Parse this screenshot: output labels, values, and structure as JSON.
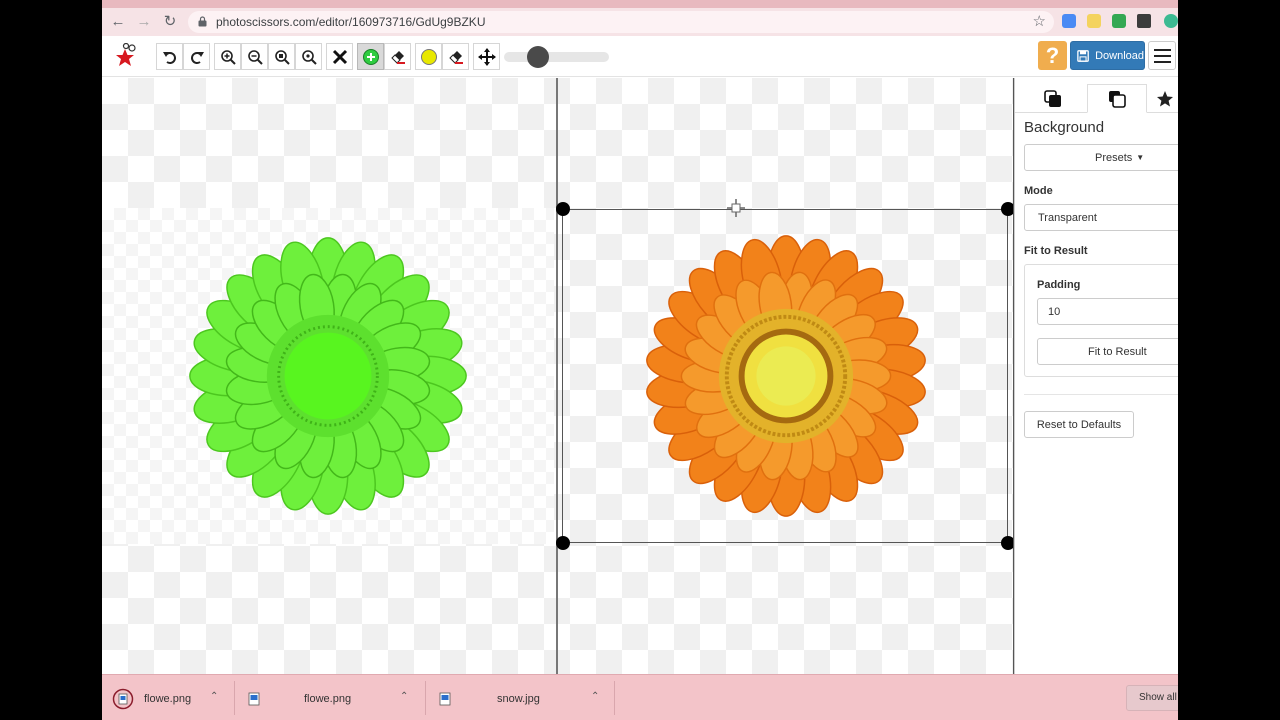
{
  "browser": {
    "url": "photoscissors.com/editor/160973716/GdUg9BZKU",
    "icons": [
      "back-icon",
      "forward-icon",
      "reload-icon",
      "lock-icon",
      "star-icon",
      "extension-icon",
      "puzzle-icon",
      "profile-icon"
    ]
  },
  "toolbar": {
    "buttons": [
      "undo",
      "redo",
      "zoom-in",
      "zoom-out",
      "zoom-fit",
      "zoom-actual",
      "clear",
      "keep-marker",
      "keep-eraser",
      "remove-marker",
      "remove-eraser",
      "pan"
    ],
    "help_label": "?",
    "download_label": "Download",
    "brush_size": 0.35,
    "colors": {
      "keep": "#2ecc40",
      "remove": "#e8e800",
      "download_bg": "#337ab7",
      "help_bg": "#f0ad4e"
    }
  },
  "canvas": {
    "left_flower_color": "#6ef03c",
    "right_flower_petal_color": "#f2821a",
    "right_flower_center_color": "#f0e040"
  },
  "sidebar": {
    "tabs": [
      "foreground-tab",
      "background-tab",
      "favorites-tab"
    ],
    "heading": "Background",
    "presets_label": "Presets",
    "mode_label": "Mode",
    "mode_value": "Transparent",
    "fit_heading": "Fit to Result",
    "padding_label": "Padding",
    "padding_value": "10",
    "fit_button_label": "Fit to Result",
    "reset_label": "Reset to Defaults"
  },
  "downloads": {
    "items": [
      {
        "name": "flowe.png"
      },
      {
        "name": "flowe.png"
      },
      {
        "name": "snow.jpg"
      }
    ],
    "show_all_label": "Show all"
  }
}
